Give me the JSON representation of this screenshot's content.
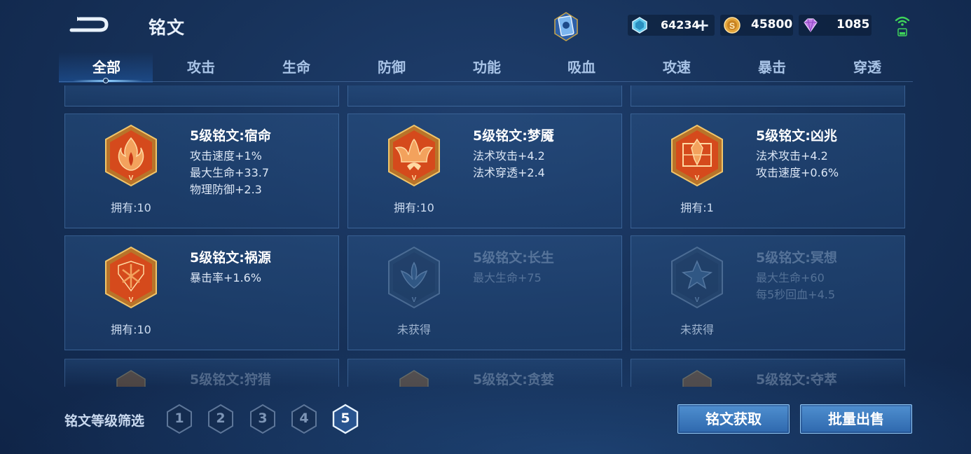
{
  "header": {
    "title": "铭文",
    "currencies": [
      {
        "icon": "coupon-crystal-icon",
        "value": "64234"
      },
      {
        "icon": "gold-coin-icon",
        "value": "45800"
      },
      {
        "icon": "diamond-icon",
        "value": "1085"
      }
    ]
  },
  "tabs": [
    {
      "label": "全部",
      "active": true
    },
    {
      "label": "攻击"
    },
    {
      "label": "生命"
    },
    {
      "label": "防御"
    },
    {
      "label": "功能"
    },
    {
      "label": "吸血"
    },
    {
      "label": "攻速"
    },
    {
      "label": "暴击"
    },
    {
      "label": "穿透"
    }
  ],
  "inscriptions": [
    {
      "name": "5级铭文:宿命",
      "stats": [
        "攻击速度+1%",
        "最大生命+33.7",
        "物理防御+2.3"
      ],
      "owned": "拥有:10",
      "icon": "flame-emblem-icon",
      "locked": false
    },
    {
      "name": "5级铭文:梦魇",
      "stats": [
        "法术攻击+4.2",
        "法术穿透+2.4"
      ],
      "owned": "拥有:10",
      "icon": "nightmare-emblem-icon",
      "locked": false
    },
    {
      "name": "5级铭文:凶兆",
      "stats": [
        "法术攻击+4.2",
        "攻击速度+0.6%"
      ],
      "owned": "拥有:1",
      "icon": "omen-emblem-icon",
      "locked": false
    },
    {
      "name": "5级铭文:祸源",
      "stats": [
        "暴击率+1.6%"
      ],
      "owned": "拥有:10",
      "icon": "calamity-emblem-icon",
      "locked": false
    },
    {
      "name": "5级铭文:长生",
      "stats": [
        "最大生命+75"
      ],
      "owned": "未获得",
      "icon": "longevity-emblem-icon",
      "locked": true
    },
    {
      "name": "5级铭文:冥想",
      "stats": [
        "最大生命+60",
        "每5秒回血+4.5"
      ],
      "owned": "未获得",
      "icon": "meditation-emblem-icon",
      "locked": true
    }
  ],
  "partial_row": [
    {
      "name": "5级铭文:狩猎"
    },
    {
      "name": "5级铭文:贪婪"
    },
    {
      "name": "5级铭文:夺萃"
    }
  ],
  "footer": {
    "filter_label": "铭文等级筛选",
    "levels": [
      "1",
      "2",
      "3",
      "4",
      "5"
    ],
    "active_level": "5",
    "acquire_label": "铭文获取",
    "sell_label": "批量出售"
  }
}
